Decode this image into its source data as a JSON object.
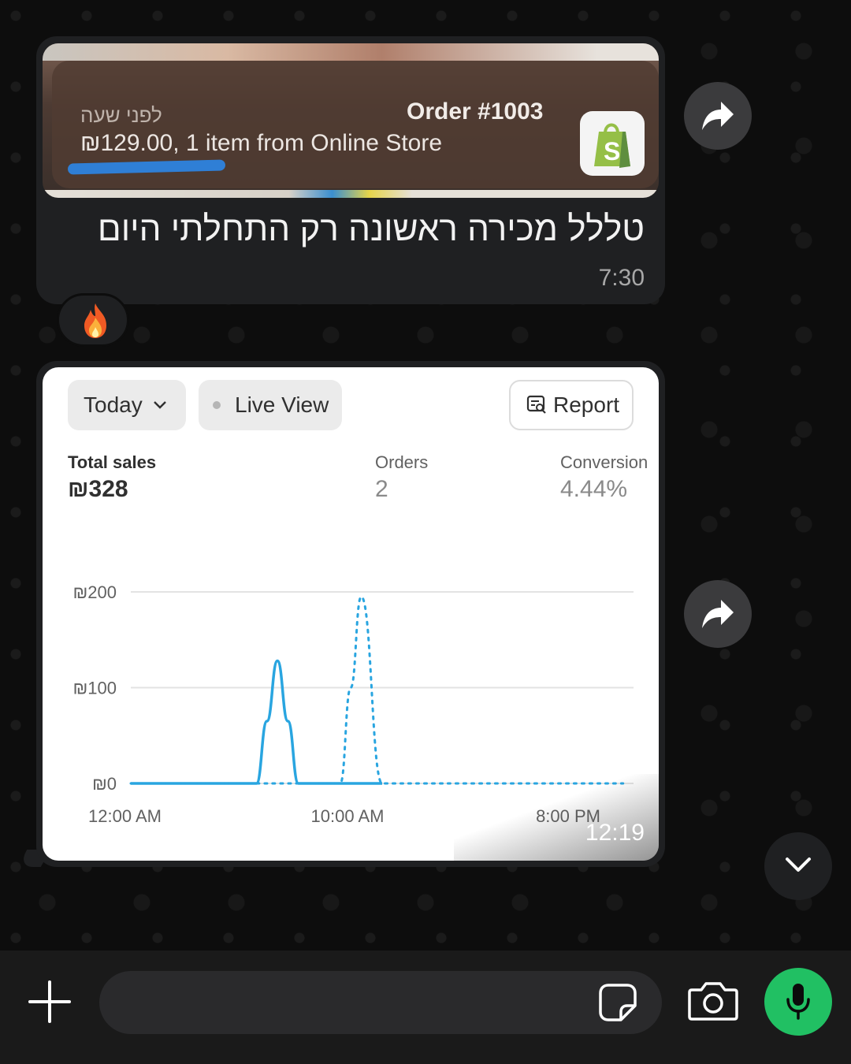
{
  "chat": {
    "message1": {
      "notification": {
        "time": "לפני שעה",
        "title": "Order #1003",
        "body": "₪129.00, 1 item from Online Store",
        "app_icon": "shopify-bag-icon"
      },
      "text": "טללל מכירה ראשונה רק התחלתי היום",
      "time": "7:30",
      "reaction": "🔥"
    },
    "message2": {
      "time": "12:19",
      "screenshot": {
        "filters": {
          "date_label": "Today",
          "live_view_label": "Live View",
          "report_label": "Report"
        },
        "metrics": {
          "total_sales_label": "Total sales",
          "total_sales_value": "₪328",
          "orders_label": "Orders",
          "orders_value": "2",
          "conversion_label": "Conversion",
          "conversion_value": "4.44%"
        },
        "chart_data": {
          "type": "line",
          "title": "",
          "xlabel": "",
          "ylabel": "",
          "y_ticks": [
            "₪200",
            "₪100",
            "₪0"
          ],
          "ylim": [
            0,
            200
          ],
          "x_ticks": [
            "12:00 AM",
            "10:00 AM",
            "8:00 PM"
          ],
          "series": [
            {
              "style": "solid",
              "x": [
                0,
                6,
                6.5,
                7,
                7.5,
                8,
                10,
                10.5,
                11,
                11.5,
                12
              ],
              "values": [
                0,
                0,
                65,
                128,
                65,
                0,
                0,
                0,
                0,
                0,
                0
              ],
              "color": "#29a5e0"
            },
            {
              "style": "dotted",
              "x": [
                0,
                10,
                10.5,
                11,
                12,
                14,
                16,
                18,
                20,
                22,
                23.5
              ],
              "values": [
                0,
                0,
                100,
                195,
                0,
                0,
                0,
                0,
                0,
                0,
                0
              ],
              "color": "#29a5e0"
            }
          ]
        }
      }
    }
  },
  "composer": {
    "placeholder": "",
    "icons": {
      "attach": "plus-icon",
      "sticker": "sticker-icon",
      "camera": "camera-icon",
      "mic": "microphone-icon"
    }
  },
  "colors": {
    "accent_green": "#21c063",
    "bubble": "#1f2022",
    "chart_line": "#29a5e0"
  }
}
